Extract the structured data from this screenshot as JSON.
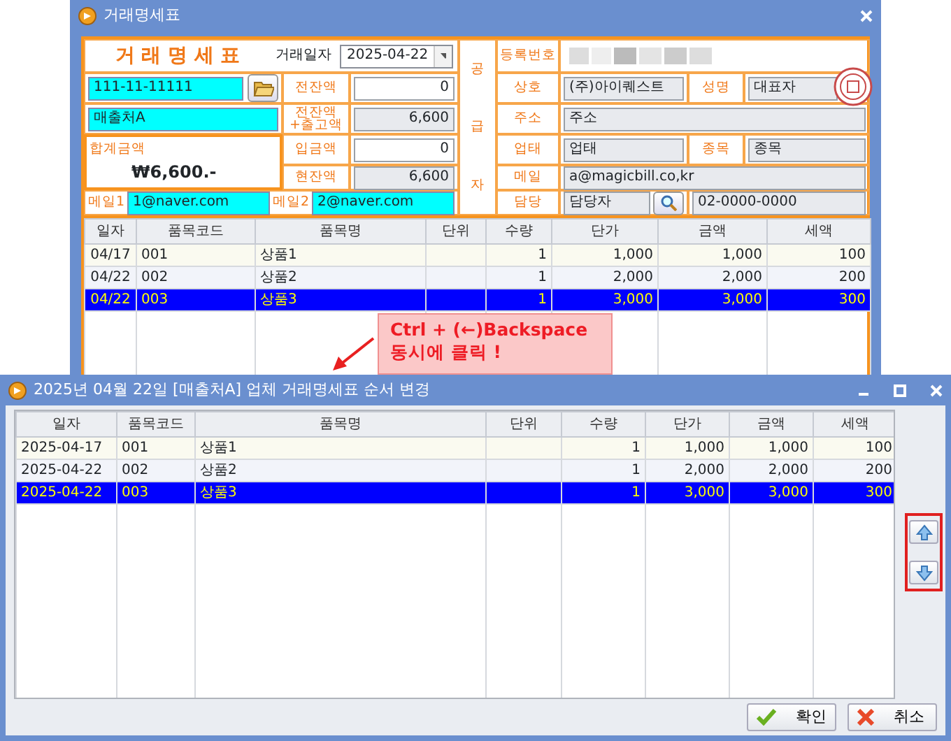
{
  "window": {
    "title": "거래명세표"
  },
  "form": {
    "title": "거 래 명 세 표",
    "date_label": "거래일자",
    "date": "2025-04-22",
    "customer": {
      "biz_no": "111-11-11111",
      "name": "매출처A"
    },
    "total_label": "합계금액",
    "total": "₩6,600.-",
    "balances": [
      {
        "lines": [
          "전잔액"
        ],
        "value": "0",
        "readonly": false
      },
      {
        "lines": [
          "전잔액",
          "+출고액"
        ],
        "value": "6,600",
        "readonly": true
      },
      {
        "lines": [
          "입금액"
        ],
        "value": "0",
        "readonly": false
      },
      {
        "lines": [
          "현잔액"
        ],
        "value": "6,600",
        "readonly": true
      }
    ],
    "emails": [
      {
        "label": "메일1",
        "value": "1@naver.com"
      },
      {
        "label": "메일2",
        "value": "2@naver.com"
      }
    ],
    "supplier_label": [
      "공",
      "급",
      "자"
    ],
    "supplier": {
      "reg_label": "등록번호",
      "company_label": "상호",
      "company": "(주)아이퀘스트",
      "ceo_label": "성명",
      "ceo": "대표자",
      "address_label": "주소",
      "address": "주소",
      "business_label": "업태",
      "business": "업태",
      "item_label": "종목",
      "item": "종목",
      "email_label": "메일",
      "email": "a@magicbill.co,kr",
      "contact_label": "담당",
      "contact": "담당자",
      "phone": "02-0000-0000"
    }
  },
  "grid": {
    "columns": [
      "일자",
      "품목코드",
      "품목명",
      "단위",
      "수량",
      "단가",
      "금액",
      "세액"
    ],
    "rows": [
      {
        "date": "04/17",
        "code": "001",
        "name": "상품1",
        "qty": "1",
        "price": "1,000",
        "amount": "1,000",
        "tax": "100",
        "selected": false
      },
      {
        "date": "04/22",
        "code": "002",
        "name": "상품2",
        "qty": "1",
        "price": "2,000",
        "amount": "2,000",
        "tax": "200",
        "selected": false
      },
      {
        "date": "04/22",
        "code": "003",
        "name": "상품3",
        "qty": "1",
        "price": "3,000",
        "amount": "3,000",
        "tax": "300",
        "selected": true
      }
    ]
  },
  "callout": {
    "text": "Ctrl + (←)Backspace\n동시에 클릭 !"
  },
  "dialog": {
    "title": "2025년 04월 22일 [매출처A] 업체 거래명세표 순서 변경",
    "columns": [
      "일자",
      "품목코드",
      "품목명",
      "단위",
      "수량",
      "단가",
      "금액",
      "세액"
    ],
    "rows": [
      {
        "date": "2025-04-17",
        "code": "001",
        "name": "상품1",
        "qty": "1",
        "price": "1,000",
        "amount": "1,000",
        "tax": "100",
        "selected": false
      },
      {
        "date": "2025-04-22",
        "code": "002",
        "name": "상품2",
        "qty": "1",
        "price": "2,000",
        "amount": "2,000",
        "tax": "200",
        "selected": false
      },
      {
        "date": "2025-04-22",
        "code": "003",
        "name": "상품3",
        "qty": "1",
        "price": "3,000",
        "amount": "3,000",
        "tax": "300",
        "selected": true
      }
    ],
    "buttons": [
      {
        "label": "확인",
        "kind": "ok"
      },
      {
        "label": "취소",
        "kind": "cancel"
      }
    ]
  }
}
